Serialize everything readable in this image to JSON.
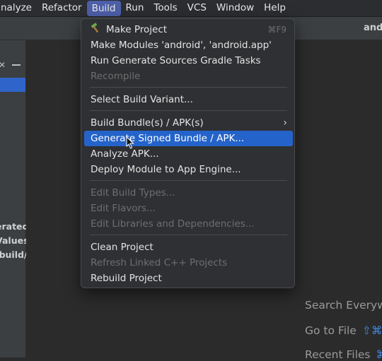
{
  "menubar": {
    "items": [
      "nalyze",
      "Refactor",
      "Build",
      "Run",
      "Tools",
      "VCS",
      "Window",
      "Help"
    ]
  },
  "toolbar": {
    "project_name": "andr"
  },
  "left_panel": {
    "truncated_lines": [
      "erated",
      "Values",
      "/build/"
    ]
  },
  "build_menu": {
    "items": [
      {
        "label": "Make Project",
        "shortcut": "⌘F9",
        "icon": "hammer-icon"
      },
      {
        "label": "Make Modules 'android', 'android.app'"
      },
      {
        "label": "Run Generate Sources Gradle Tasks"
      },
      {
        "label": "Recompile",
        "disabled": true
      },
      {
        "label": "Select Build Variant..."
      },
      {
        "label": "Build Bundle(s) / APK(s)",
        "submenu": true
      },
      {
        "label": "Generate Signed Bundle / APK...",
        "highlighted": true
      },
      {
        "label": "Analyze APK..."
      },
      {
        "label": "Deploy Module to App Engine..."
      },
      {
        "label": "Edit Build Types...",
        "disabled": true
      },
      {
        "label": "Edit Flavors...",
        "disabled": true
      },
      {
        "label": "Edit Libraries and Dependencies...",
        "disabled": true
      },
      {
        "label": "Clean Project"
      },
      {
        "label": "Refresh Linked C++ Projects",
        "disabled": true
      },
      {
        "label": "Rebuild Project"
      }
    ]
  },
  "hints": {
    "search_everywhere": "Search Everywh",
    "goto_file": "Go to File",
    "goto_file_key": "⇧⌘O",
    "recent_files": "Recent Files",
    "recent_files_key": "⌘"
  },
  "colors": {
    "menu_active": "#4d5fa8",
    "highlight": "#2463c9",
    "selection": "#2f65ca",
    "key_text": "#3d8be6"
  }
}
